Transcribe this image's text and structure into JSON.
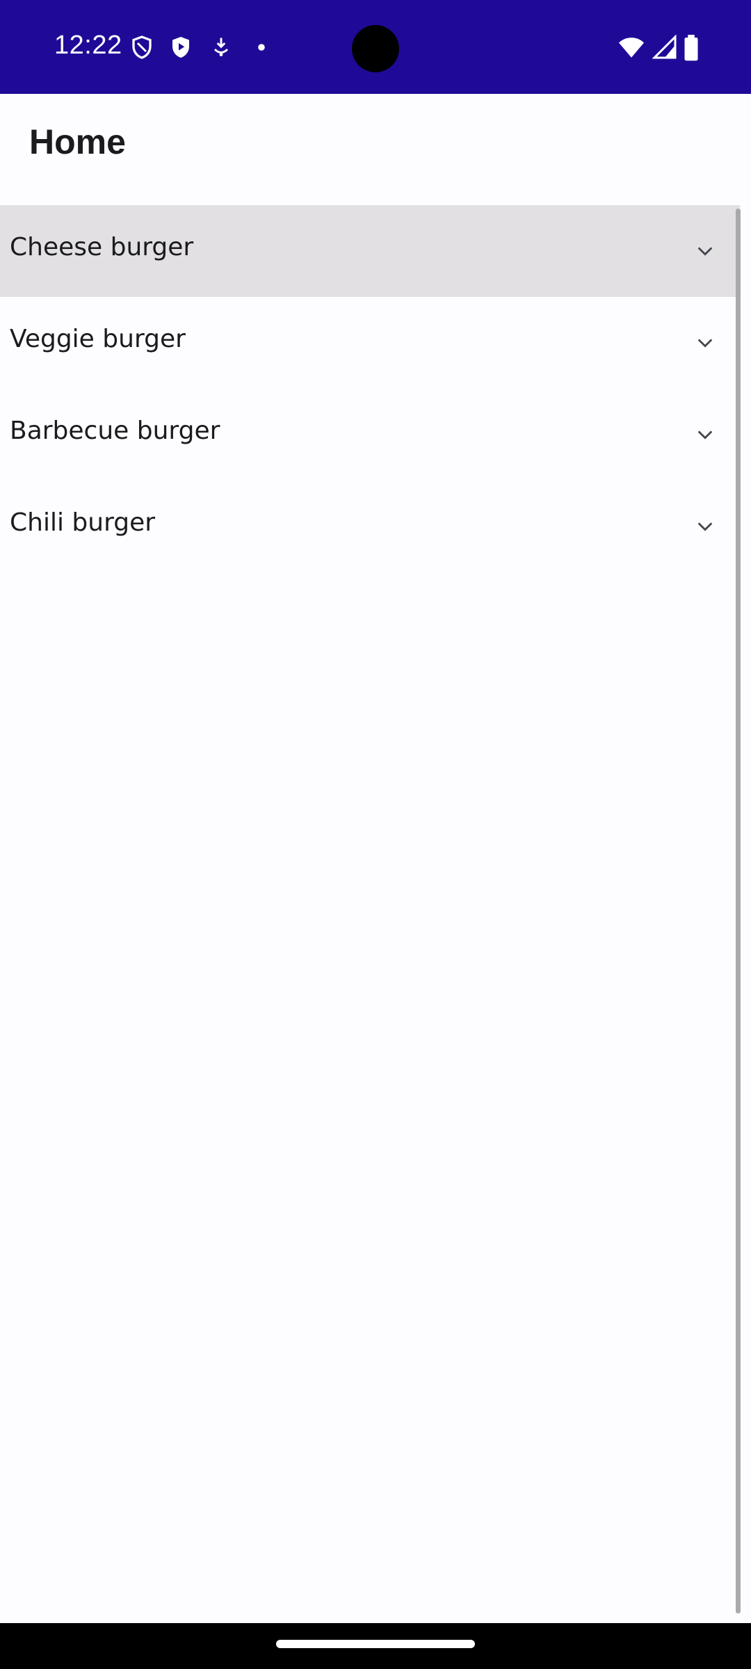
{
  "status_bar": {
    "time": "12:22",
    "left_icons": [
      "shield-outline-icon",
      "play-shield-icon",
      "download-icon",
      "dot-icon"
    ],
    "right_icons": [
      "wifi-icon",
      "signal-icon",
      "battery-icon"
    ],
    "background": "#1f0a98"
  },
  "header": {
    "title": "Home"
  },
  "list": {
    "items": [
      {
        "label": "Cheese burger",
        "selected": true
      },
      {
        "label": "Veggie burger",
        "selected": false
      },
      {
        "label": "Barbecue burger",
        "selected": false
      },
      {
        "label": "Chili burger",
        "selected": false
      }
    ]
  },
  "colors": {
    "status_bar": "#1f0a98",
    "selected_row": "#e2e0e3",
    "page_background": "#fdfcff",
    "text": "#1b1b1f"
  }
}
